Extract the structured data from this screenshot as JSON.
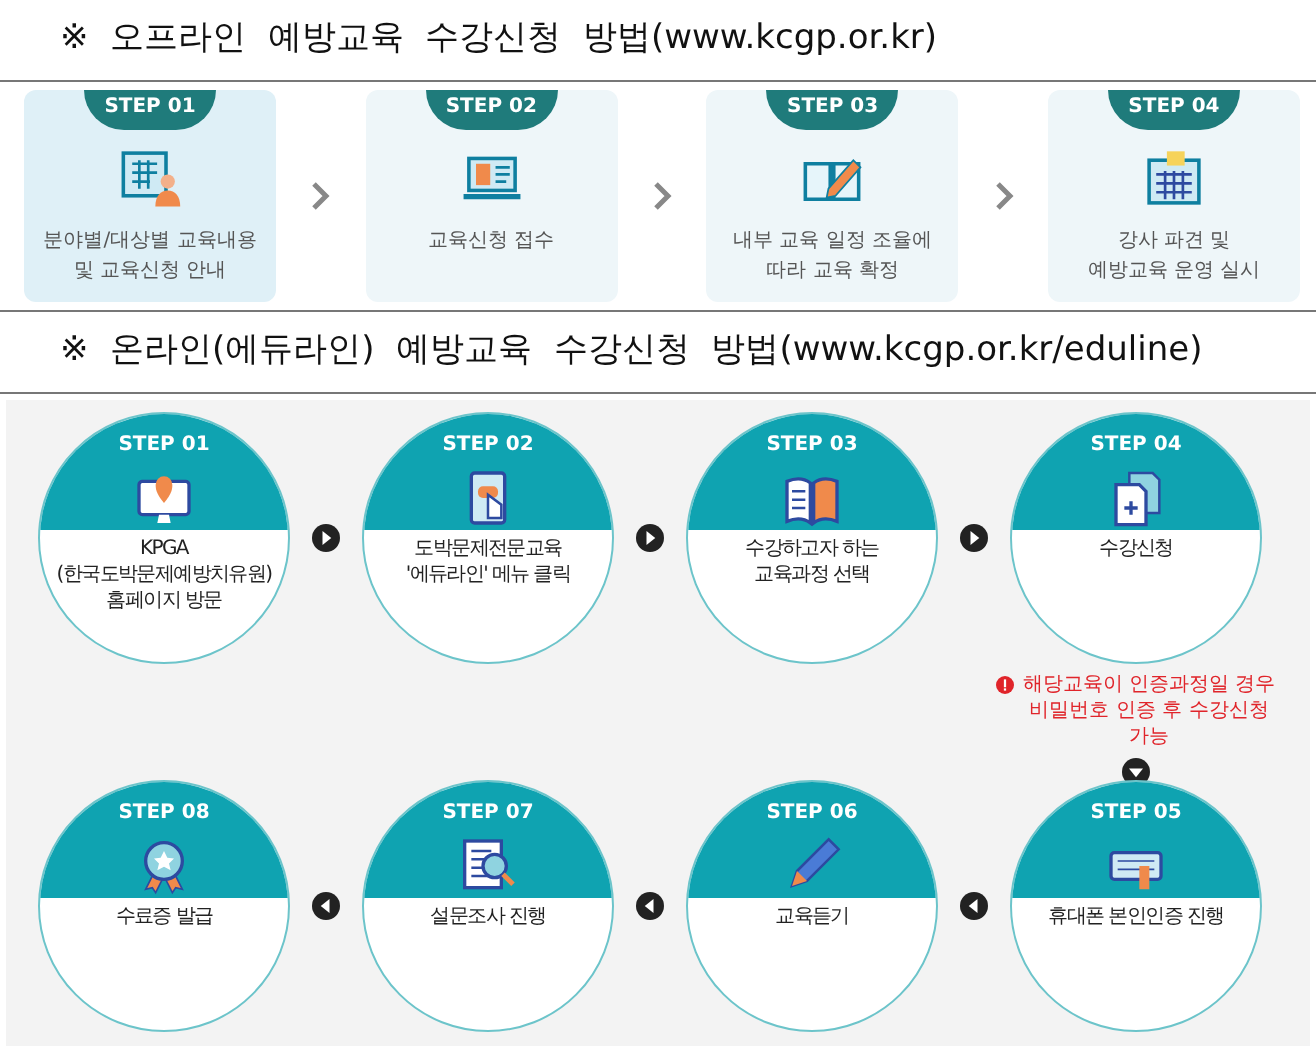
{
  "offline": {
    "heading": "※  오프라인  예방교육  수강신청  방법(www.kcgp.or.kr)",
    "steps": [
      {
        "step": "STEP 01",
        "text": "분야별/대상별 교육내용\n및 교육신청 안내",
        "selected": true
      },
      {
        "step": "STEP 02",
        "text": "교육신청 접수",
        "selected": false
      },
      {
        "step": "STEP 03",
        "text": "내부 교육 일정 조율에\n따라 교육 확정",
        "selected": false
      },
      {
        "step": "STEP 04",
        "text": "강사 파견 및\n예방교육 운영 실시",
        "selected": false
      }
    ]
  },
  "online": {
    "heading": "※  온라인(에듀라인)  예방교육  수강신청  방법(www.kcgp.or.kr/eduline)",
    "rows": [
      [
        {
          "step": "STEP 01",
          "text": "KPGA\n(한국도박문제예방치유원)\n홈페이지 방문"
        },
        {
          "step": "STEP 02",
          "text": "도박문제전문교육\n'에듀라인' 메뉴 클릭"
        },
        {
          "step": "STEP 03",
          "text": "수강하고자 하는\n교육과정 선택"
        },
        {
          "step": "STEP 04",
          "text": "수강신청"
        }
      ],
      [
        {
          "step": "STEP 08",
          "text": "수료증 발급"
        },
        {
          "step": "STEP 07",
          "text": "설문조사 진행"
        },
        {
          "step": "STEP 06",
          "text": "교육듣기"
        },
        {
          "step": "STEP 05",
          "text": "휴대폰 본인인증 진행"
        }
      ]
    ],
    "note": "해당교육이 인증과정일 경우\n비밀번호 인증 후 수강신청\n가능"
  }
}
